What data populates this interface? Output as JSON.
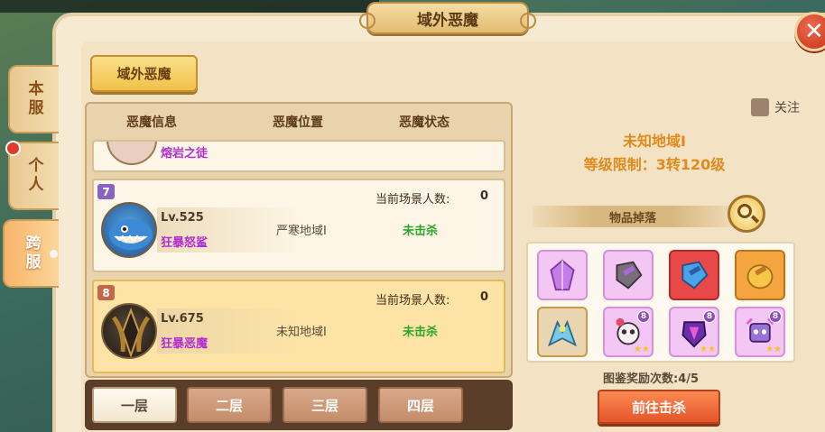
{
  "window": {
    "title": "域外恶魔"
  },
  "side_tabs": [
    {
      "label": "本服",
      "active": false
    },
    {
      "label": "个人",
      "active": false
    },
    {
      "label": "跨服",
      "active": true
    }
  ],
  "category_button": "域外恶魔",
  "table": {
    "headers": [
      "恶魔信息",
      "恶魔位置",
      "恶魔状态"
    ],
    "partial_row": {
      "name": "熔岩之徒"
    },
    "rows": [
      {
        "rank": "7",
        "level": "Lv.525",
        "name": "狂暴怒鲨",
        "location": "严寒地域I",
        "count_label": "当前场景人数:",
        "count_value": "0",
        "status": "未击杀",
        "selected": false
      },
      {
        "rank": "8",
        "level": "Lv.675",
        "name": "狂暴恶魔",
        "location": "未知地域I",
        "count_label": "当前场景人数:",
        "count_value": "0",
        "status": "未击杀",
        "selected": true
      }
    ]
  },
  "floor_tabs": [
    "一层",
    "二层",
    "三层",
    "四层"
  ],
  "detail": {
    "follow_label": "关注",
    "zone_name": "未知地域I",
    "level_limit": "等级限制：3转120级",
    "drops_label": "物品掉落",
    "reward_count": "图鉴奖励次数:4/5",
    "go_button": "前往击杀"
  },
  "drop_items": [
    {
      "icon": "purple-crystal-icon",
      "color": "#e8a8f0",
      "badge": ""
    },
    {
      "icon": "hammer-stone-icon",
      "color": "#f2b6e8",
      "badge": ""
    },
    {
      "icon": "hammer-red-icon",
      "color": "#e35a5a",
      "badge": ""
    },
    {
      "icon": "hammer-gold-icon",
      "color": "#f4a040",
      "badge": ""
    },
    {
      "icon": "winged-creature-icon",
      "color": "#e4cfa6",
      "badge": ""
    },
    {
      "icon": "skull-bomb-icon",
      "color": "#e8a8f0",
      "badge": "8"
    },
    {
      "icon": "dark-armor-icon",
      "color": "#e8a8f0",
      "badge": "8"
    },
    {
      "icon": "mech-warrior-icon",
      "color": "#e8a8f0",
      "badge": "8"
    }
  ]
}
